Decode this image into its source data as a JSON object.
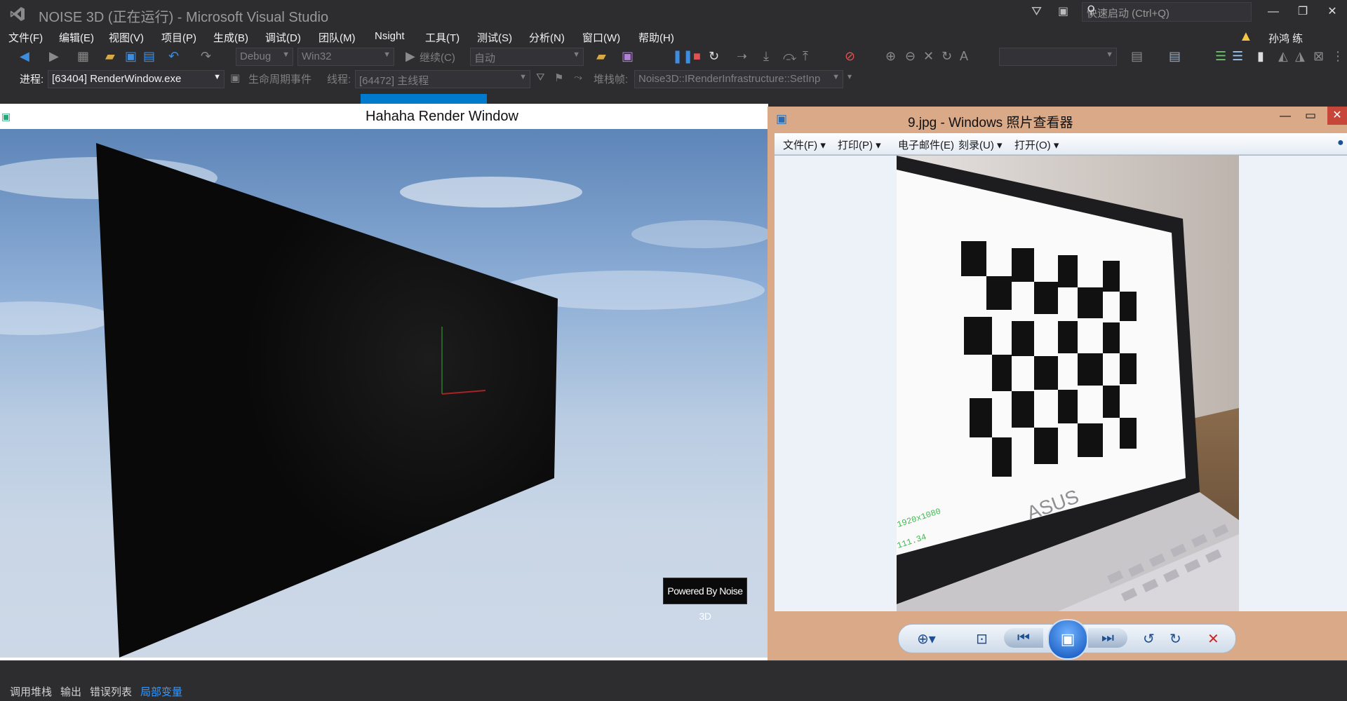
{
  "vs": {
    "title": "NOISE 3D (正在运行) - Microsoft Visual Studio",
    "quick_launch_placeholder": "快速启动 (Ctrl+Q)",
    "menu": [
      "文件(F)",
      "编辑(E)",
      "视图(V)",
      "项目(P)",
      "生成(B)",
      "调试(D)",
      "团队(M)",
      "Nsight",
      "工具(T)",
      "测试(S)",
      "分析(N)",
      "窗口(W)",
      "帮助(H)"
    ],
    "user": "孙鸿 练",
    "toolbar1": {
      "config": "Debug",
      "platform": "Win32",
      "continue_label": "继续(C)",
      "auto_label": "自动"
    },
    "toolbar2": {
      "process_label": "进程:",
      "process_value": "[63404] RenderWindow.exe",
      "lifecycle_label": "生命周期事件",
      "thread_label": "线程:",
      "thread_value": "[64472] 主线程",
      "stackframe_label": "堆栈帧:",
      "stackframe_value": "Noise3D::IRenderInfrastructure::SetInp"
    },
    "bottom_tabs": [
      "调用堆栈",
      "输出",
      "错误列表",
      "局部变量"
    ],
    "active_bottom_tab": "局部变量",
    "accent": "#007acc"
  },
  "render_window": {
    "title": "Hahaha Render Window",
    "badge": "Powered By Noise 3D"
  },
  "photo_viewer": {
    "title": "9.jpg - Windows 照片查看器",
    "menu": [
      "文件(F)",
      "打印(P)",
      "电子邮件(E)",
      "刻录(U)",
      "打开(O)"
    ],
    "photo_text": {
      "brand": "ASUS",
      "resolution": "1920x1080",
      "line2": "111.34"
    },
    "toolbar_icons": [
      "zoom-icon",
      "actual-size-icon",
      "previous-icon",
      "slideshow-icon",
      "next-icon",
      "rotate-left-icon",
      "rotate-right-icon",
      "delete-icon"
    ]
  }
}
